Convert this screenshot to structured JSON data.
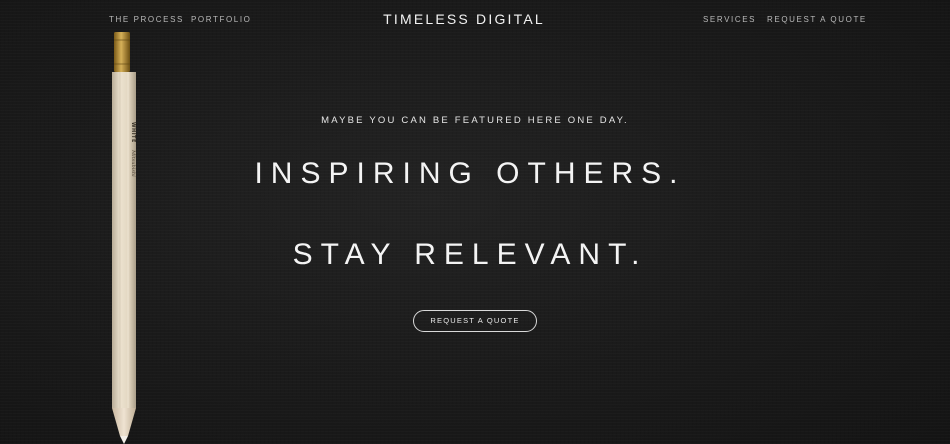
{
  "nav": {
    "left_links": [
      "THE PROCESS",
      "PORTFOLIO"
    ],
    "brand": "TIMELESS DIGITAL",
    "right_links": [
      "SERVICES",
      "REQUEST A QUOTE"
    ]
  },
  "hero": {
    "kicker": "MAYBE YOU CAN BE FEATURED HERE ONE DAY.",
    "line1": "INSPIRING OTHERS.",
    "line2": "STAY RELEVANT.",
    "cta_label": "REQUEST A QUOTE"
  },
  "pencil": {
    "label": "WHITE",
    "brand_script": "Mitsubishi"
  },
  "colors": {
    "background": "#1a1a1a",
    "text": "#f4f4f4",
    "nav_text": "#b9b9b9",
    "pencil_body": "#e8dcc8",
    "pencil_cap": "#b48a2c"
  }
}
